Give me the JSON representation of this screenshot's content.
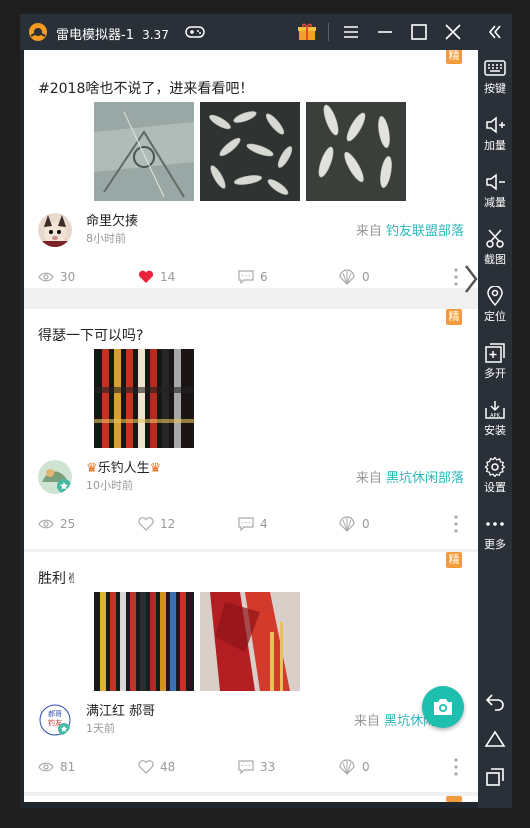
{
  "window": {
    "title": "雷电模拟器-1",
    "version": "3.37"
  },
  "sidebar": {
    "items": [
      {
        "label": "按键",
        "icon": "keyboard-icon"
      },
      {
        "label": "加量",
        "icon": "volume-up-icon"
      },
      {
        "label": "减量",
        "icon": "volume-down-icon"
      },
      {
        "label": "截图",
        "icon": "scissors-icon"
      },
      {
        "label": "定位",
        "icon": "location-pin-icon"
      },
      {
        "label": "多开",
        "icon": "multi-instance-icon"
      },
      {
        "label": "安装",
        "icon": "apk-install-icon"
      },
      {
        "label": "设置",
        "icon": "gear-icon"
      },
      {
        "label": "更多",
        "icon": "more-dots-icon"
      }
    ]
  },
  "feed": {
    "posts": [
      {
        "badge": "精",
        "title": "#2018啥也不说了，进来看看吧！",
        "user": "命里欠揍",
        "time": "8小时前",
        "from_prefix": "来自",
        "tribe": "钓友联盟部落",
        "views": "30",
        "likes": "14",
        "comments": "6",
        "shares": "0",
        "liked": true
      },
      {
        "badge": "精",
        "title": "得瑟一下可以吗?",
        "user": "乐钓人生",
        "time": "10小时前",
        "from_prefix": "来自",
        "tribe": "黑坑休闲部落",
        "views": "25",
        "likes": "12",
        "comments": "4",
        "shares": "0",
        "liked": false
      },
      {
        "badge": "精",
        "title": "胜利✌",
        "user": "满江红 郝哥",
        "time": "1天前",
        "from_prefix": "来自",
        "tribe": "黑坑休闲",
        "views": "81",
        "likes": "48",
        "comments": "33",
        "shares": "0",
        "liked": false
      }
    ]
  },
  "colors": {
    "accent": "#2bb7bd",
    "badge": "#f49a3e",
    "like_active": "#e8233a",
    "fab": "#1fbfb0"
  }
}
